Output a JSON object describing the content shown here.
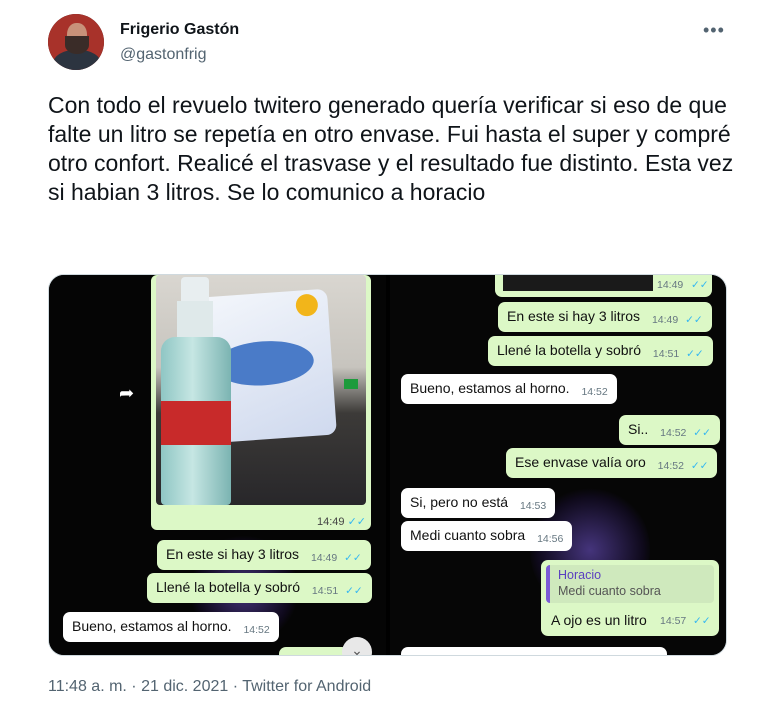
{
  "author": {
    "name": "Frigerio Gastón",
    "handle": "@gastonfrig",
    "more_icon": "more-horizontal-icon"
  },
  "tweet": {
    "text": "Con todo el revuelo twitero generado quería verificar si eso de que falte un litro se repetía en otro envase. Fui hasta el super y compré otro confort. Realicé el trasvase y el resultado fue distinto. Esta vez si habian 3 litros. Se lo comunico a horacio"
  },
  "media": {
    "left_screenshot": {
      "photo_time": "14:49",
      "messages": [
        {
          "text": "En este si hay 3 litros",
          "time": "14:49",
          "direction": "out"
        },
        {
          "text": "Llené la botella y sobró",
          "time": "14:51",
          "direction": "out"
        },
        {
          "text": "Bueno, estamos al horno.",
          "time": "14:52",
          "direction": "in"
        }
      ]
    },
    "right_screenshot": {
      "top_time": "14:49",
      "messages": [
        {
          "text": "En este si hay 3 litros",
          "time": "14:49",
          "direction": "out"
        },
        {
          "text": "Llené la botella y sobró",
          "time": "14:51",
          "direction": "out"
        },
        {
          "text": "Bueno, estamos al horno.",
          "time": "14:52",
          "direction": "in"
        },
        {
          "text": "Si..",
          "time": "14:52",
          "direction": "out"
        },
        {
          "text": "Ese envase valía oro",
          "time": "14:52",
          "direction": "out"
        },
        {
          "text": "Si, pero no está",
          "time": "14:53",
          "direction": "in"
        },
        {
          "text": "Medi cuanto sobra",
          "time": "14:56",
          "direction": "in"
        }
      ],
      "reply": {
        "quoted_name": "Horacio",
        "quoted_text": "Medi cuanto sobra",
        "text": "A ojo es un litro",
        "time": "14:57"
      }
    },
    "ticks": "✓✓"
  },
  "footer": {
    "time": "11:48 a. m.",
    "separator": " · ",
    "date": "21 dic. 2021",
    "source": "Twitter for Android"
  },
  "colors": {
    "out_bubble": "#dcf8c6",
    "in_bubble": "#ffffff",
    "tick_blue": "#34b7f1",
    "secondary_text": "#536471"
  }
}
